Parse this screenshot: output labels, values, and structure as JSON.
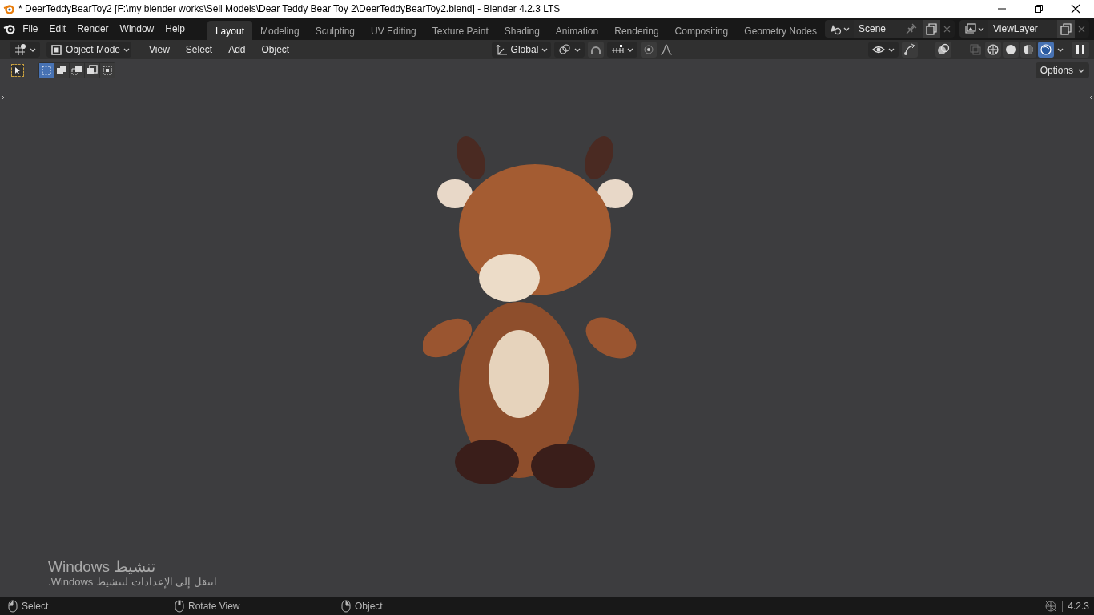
{
  "window": {
    "title": "* DeerTeddyBearToy2 [F:\\my blender works\\Sell Models\\Dear Teddy Bear Toy 2\\DeerTeddyBearToy2.blend] - Blender 4.2.3 LTS"
  },
  "menu": [
    "File",
    "Edit",
    "Render",
    "Window",
    "Help"
  ],
  "workspaces": [
    {
      "label": "Layout",
      "selected": true
    },
    {
      "label": "Modeling",
      "selected": false
    },
    {
      "label": "Sculpting",
      "selected": false
    },
    {
      "label": "UV Editing",
      "selected": false
    },
    {
      "label": "Texture Paint",
      "selected": false
    },
    {
      "label": "Shading",
      "selected": false
    },
    {
      "label": "Animation",
      "selected": false
    },
    {
      "label": "Rendering",
      "selected": false
    },
    {
      "label": "Compositing",
      "selected": false
    },
    {
      "label": "Geometry Nodes",
      "selected": false
    }
  ],
  "scene": {
    "name": "Scene"
  },
  "view_layer": {
    "name": "ViewLayer"
  },
  "header": {
    "mode": "Object Mode",
    "menus": [
      "View",
      "Select",
      "Add",
      "Object"
    ],
    "orientation": "Global"
  },
  "select_modes": [
    {
      "selected": true
    },
    {
      "selected": false
    },
    {
      "selected": false
    },
    {
      "selected": false
    },
    {
      "selected": false
    }
  ],
  "shading_modes": [
    {
      "selected": false
    },
    {
      "selected": false
    },
    {
      "selected": false
    },
    {
      "selected": true
    }
  ],
  "options": "Options",
  "activation_notice": {
    "title": "تنشيط Windows",
    "message": "انتقل إلى الإعدادات لتنشيط Windows."
  },
  "status_bar": {
    "hints": [
      "Select",
      "Rotate View",
      "Object"
    ],
    "version": "4.2.3"
  }
}
